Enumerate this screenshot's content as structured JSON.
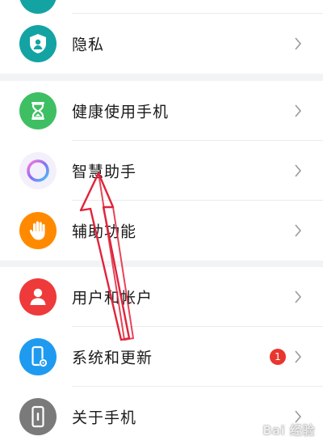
{
  "colors": {
    "privacy_icon": "#14a3a3",
    "health_icon": "#3fbf63",
    "assistant_ring": "#9b6cf2",
    "accessibility_icon": "#ff8a00",
    "users_icon": "#ee3a3a",
    "system_icon": "#1e9bf0",
    "about_icon": "#7a7a7a",
    "badge": "#e8362f",
    "annotation_arrow": "#e0243b"
  },
  "settings": {
    "items": [
      {
        "label": "隐私",
        "icon": "privacy-shield-icon"
      },
      {
        "label": "健康使用手机",
        "icon": "hourglass-icon"
      },
      {
        "label": "智慧助手",
        "icon": "assistant-ring-icon"
      },
      {
        "label": "辅助功能",
        "icon": "hand-icon"
      },
      {
        "label": "用户和帐户",
        "icon": "user-icon"
      },
      {
        "label": "系统和更新",
        "icon": "phone-gear-icon",
        "badge": "1"
      },
      {
        "label": "关于手机",
        "icon": "phone-info-icon"
      }
    ]
  },
  "watermark": "Bai 经验"
}
